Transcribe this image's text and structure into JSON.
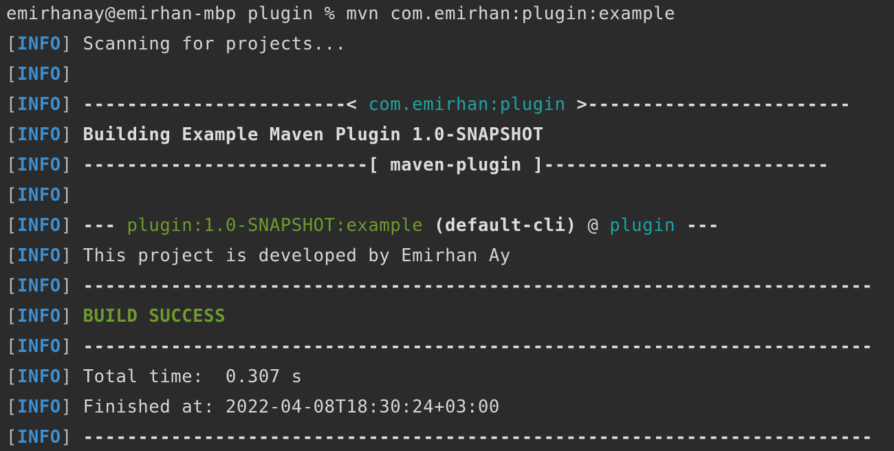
{
  "terminal": {
    "prompt": "emirhanay@emirhan-mbp plugin % mvn com.emirhan:plugin:example",
    "level": "INFO",
    "lines": [
      {
        "text": "Scanning for projects..."
      },
      {
        "text": ""
      },
      {
        "dash_left": "------------------------< ",
        "artifact": "com.emirhan:plugin",
        "dash_right": " >------------------------"
      },
      {
        "text": "Building Example Maven Plugin 1.0-SNAPSHOT"
      },
      {
        "dash_left": "--------------------------[ ",
        "packaging": "maven-plugin",
        "dash_right": " ]--------------------------"
      },
      {
        "text": ""
      },
      {
        "prefix": "--- ",
        "goal": "plugin:1.0-SNAPSHOT:example",
        "execution": " (default-cli)",
        "at": " @ ",
        "project": "plugin",
        "suffix": " ---"
      },
      {
        "text": "This project is developed by Emirhan Ay"
      },
      {
        "text": "------------------------------------------------------------------------"
      },
      {
        "text": "BUILD SUCCESS"
      },
      {
        "text": "------------------------------------------------------------------------"
      },
      {
        "text": "Total time:  0.307 s"
      },
      {
        "text": "Finished at: 2022-04-08T18:30:24+03:00"
      },
      {
        "text": "------------------------------------------------------------------------"
      }
    ]
  },
  "colors": {
    "background": "#2b2b2b",
    "text": "#d6d6d6",
    "info_label": "#3d8fd1",
    "cyan_highlight": "#1ea3a3",
    "green_highlight": "#6f9a2f"
  }
}
